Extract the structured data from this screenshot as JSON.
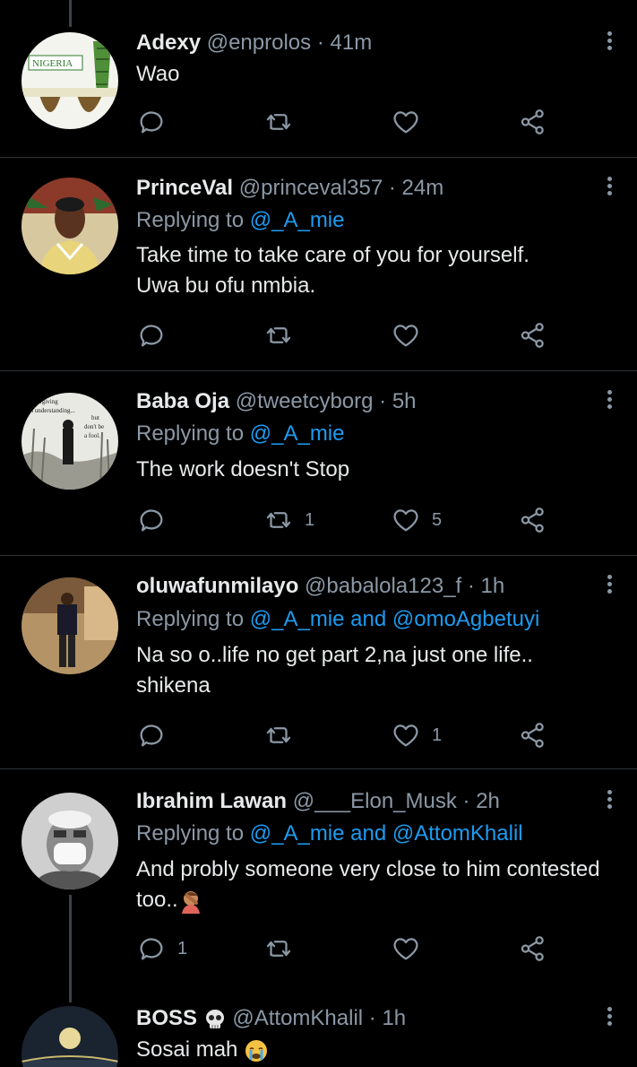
{
  "tweets": [
    {
      "name": "Adexy",
      "handle": "@enprolos",
      "time": "41m",
      "replying": null,
      "text": "Wao",
      "counts": {
        "reply": "",
        "retweet": "",
        "like": ""
      },
      "avatar": "nigeria-map-avatar"
    },
    {
      "name": "PrinceVal",
      "handle": "@princeval357",
      "time": "24m",
      "replying": {
        "prefix": "Replying to",
        "mentions": "@_A_mie"
      },
      "text": "Take time to take care of you for yourself.\nUwa bu ofu nmbia.",
      "counts": {
        "reply": "",
        "retweet": "",
        "like": ""
      },
      "avatar": "man-portrait-avatar"
    },
    {
      "name": "Baba Oja",
      "handle": "@tweetcyborg",
      "time": "5h",
      "replying": {
        "prefix": "Replying to",
        "mentions": "@_A_mie"
      },
      "text": "The work doesn't Stop",
      "counts": {
        "reply": "",
        "retweet": "1",
        "like": "5"
      },
      "avatar": "quote-sketch-avatar",
      "avatar_text": [
        "I'm forgiving",
        "I'm understanding...",
        "but",
        "don't be",
        "a fool."
      ]
    },
    {
      "name": "oluwafunmilayo",
      "handle": "@babalola123_f",
      "time": "1h",
      "replying": {
        "prefix": "Replying to",
        "mentions": "@_A_mie and @omoAgbetuyi"
      },
      "text": "Na so o..life no get part 2,na just one life..\nshikena",
      "counts": {
        "reply": "",
        "retweet": "",
        "like": "1"
      },
      "avatar": "person-standing-avatar"
    },
    {
      "name": "Ibrahim Lawan",
      "handle": "@___Elon_Musk",
      "time": "2h",
      "replying": {
        "prefix": "Replying to",
        "mentions": "@_A_mie and @AttomKhalil"
      },
      "text": "And probly someone very close to him contested\ntoo..",
      "counts": {
        "reply": "1",
        "retweet": "",
        "like": ""
      },
      "avatar": "masked-man-avatar"
    },
    {
      "name": "BOSS",
      "handle": "@AttomKhalil",
      "time": "1h",
      "replying": null,
      "text": "Sosai mah",
      "counts": {
        "reply": "",
        "retweet": "",
        "like": ""
      },
      "avatar": "moon-avatar"
    }
  ],
  "separator": "·",
  "icons": {
    "reply": "reply-icon",
    "retweet": "retweet-icon",
    "like": "like-icon",
    "share": "share-icon",
    "more": "more-icon",
    "facepalm": "facepalm-emoji",
    "skull": "skull-emoji",
    "crying": "crying-emoji"
  },
  "colors": {
    "background": "#000000",
    "text": "#e7e9ea",
    "secondary": "#8b98a5",
    "mention": "#1d9bf0",
    "divider": "#2f3336"
  }
}
